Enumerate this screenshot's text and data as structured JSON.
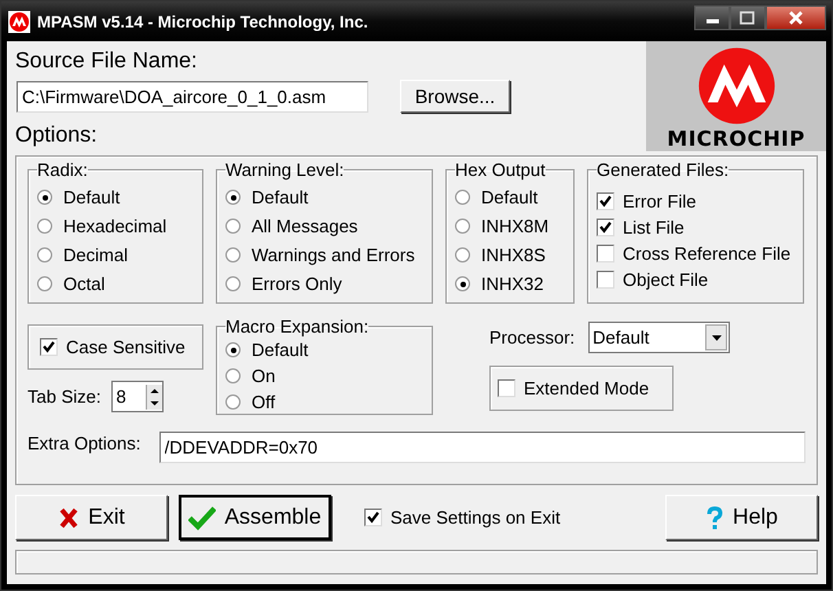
{
  "window": {
    "title": "MPASM v5.14 - Microchip Technology, Inc."
  },
  "source": {
    "label": "Source File Name:",
    "value": "C:\\Firmware\\DOA_aircore_0_1_0.asm",
    "browse": "Browse..."
  },
  "logo": {
    "text": "MICROCHIP"
  },
  "options_label": "Options:",
  "groups": [
    {
      "title": "Radix:",
      "kind": "radio",
      "items": [
        {
          "label": "Default",
          "selected": true
        },
        {
          "label": "Hexadecimal",
          "selected": false
        },
        {
          "label": "Decimal",
          "selected": false
        },
        {
          "label": "Octal",
          "selected": false
        }
      ]
    },
    {
      "title": "Warning Level:",
      "kind": "radio",
      "items": [
        {
          "label": "Default",
          "selected": true
        },
        {
          "label": "All Messages",
          "selected": false
        },
        {
          "label": "Warnings and Errors",
          "selected": false
        },
        {
          "label": "Errors Only",
          "selected": false
        }
      ]
    },
    {
      "title": "Hex Output",
      "kind": "radio",
      "items": [
        {
          "label": "Default",
          "selected": false
        },
        {
          "label": "INHX8M",
          "selected": false
        },
        {
          "label": "INHX8S",
          "selected": false
        },
        {
          "label": "INHX32",
          "selected": true
        }
      ]
    },
    {
      "title": "Generated Files:",
      "kind": "check",
      "items": [
        {
          "label": "Error File",
          "checked": true
        },
        {
          "label": "List File",
          "checked": true
        },
        {
          "label": "Cross Reference File",
          "checked": false
        },
        {
          "label": "Object File",
          "checked": false
        }
      ]
    }
  ],
  "case_sensitive": {
    "label": "Case Sensitive",
    "checked": true
  },
  "tab_size": {
    "label": "Tab Size:",
    "value": "8"
  },
  "macro": {
    "title": "Macro Expansion:",
    "items": [
      {
        "label": "Default",
        "selected": true
      },
      {
        "label": "On",
        "selected": false
      },
      {
        "label": "Off",
        "selected": false
      }
    ]
  },
  "processor": {
    "label": "Processor:",
    "value": "Default"
  },
  "extended": {
    "label": "Extended Mode",
    "checked": false
  },
  "extra": {
    "label": "Extra Options:",
    "value": "/DDEVADDR=0x70"
  },
  "exit_button": "Exit",
  "assemble_button": "Assemble",
  "save_settings": {
    "label": "Save Settings on Exit",
    "checked": true
  },
  "help_button": "Help"
}
